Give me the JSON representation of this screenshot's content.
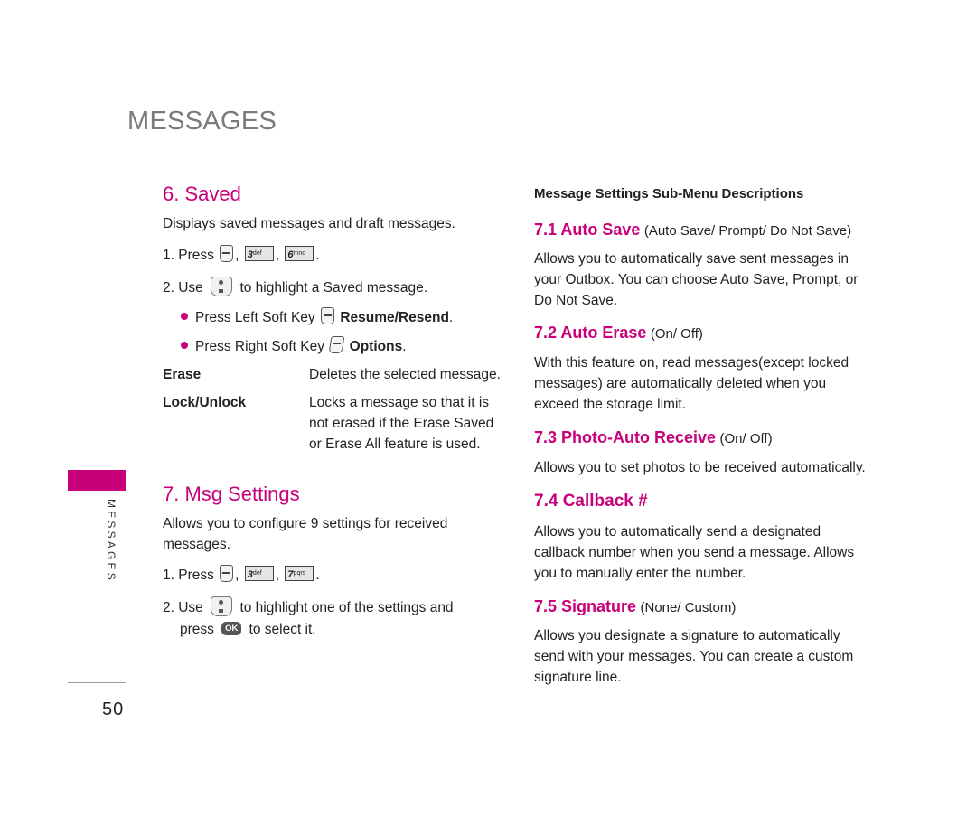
{
  "header": {
    "title": "MESSAGES"
  },
  "side_tab": {
    "label": "MESSAGES",
    "accent": "#c8007a"
  },
  "page_number": "50",
  "left": {
    "saved": {
      "title": "6. Saved",
      "description": "Displays saved messages and draft messages.",
      "step1": {
        "prefix": "1. Press",
        "keys": [
          {
            "num": "3",
            "letters": "def"
          },
          {
            "num": "6",
            "letters": "mno"
          }
        ]
      },
      "step2": {
        "prefix": "2. Use",
        "suffix": "to highlight a Saved message."
      },
      "bullets": [
        {
          "text": "Press Left Soft Key",
          "action": "Resume/Resend"
        },
        {
          "text": "Press Right Soft Key",
          "action": "Options"
        }
      ],
      "options": [
        {
          "term": "Erase",
          "desc": "Deletes the selected message."
        },
        {
          "term": "Lock/Unlock",
          "desc": "Locks a message so that it is not erased if the Erase Saved or Erase All feature is used."
        }
      ]
    },
    "msg_settings": {
      "title": "7. Msg Settings",
      "description": "Allows you to configure 9 settings for received messages.",
      "step1": {
        "prefix": "1. Press",
        "keys": [
          {
            "num": "3",
            "letters": "def"
          },
          {
            "num": "7",
            "letters": "pqrs"
          }
        ]
      },
      "step2": {
        "prefix": "2. Use",
        "middle": "to highlight one of the settings and",
        "press": "press",
        "ok": "OK",
        "suffix": "to select it."
      }
    }
  },
  "right": {
    "heading": "Message Settings Sub-Menu Descriptions",
    "items": [
      {
        "title": "7.1 Auto Save",
        "options": "(Auto Save/ Prompt/ Do Not Save)",
        "text": "Allows you to automatically save sent messages in your Outbox. You can choose Auto Save, Prompt, or Do Not Save."
      },
      {
        "title": "7.2 Auto Erase",
        "options": "(On/ Off)",
        "text": "With this feature on, read messages(except locked messages) are automatically deleted when you exceed the storage limit."
      },
      {
        "title": "7.3 Photo-Auto Receive",
        "options": "(On/ Off)",
        "text": "Allows you to set photos to be received automatically."
      },
      {
        "title": "7.4 Callback #",
        "options": "",
        "text": "Allows you to automatically send a designated callback number when you send a message. Allows you to manually enter the number."
      },
      {
        "title": "7.5 Signature",
        "options": "(None/ Custom)",
        "text": "Allows you designate a signature to automatically send with your messages. You can create a custom signature line."
      }
    ]
  }
}
